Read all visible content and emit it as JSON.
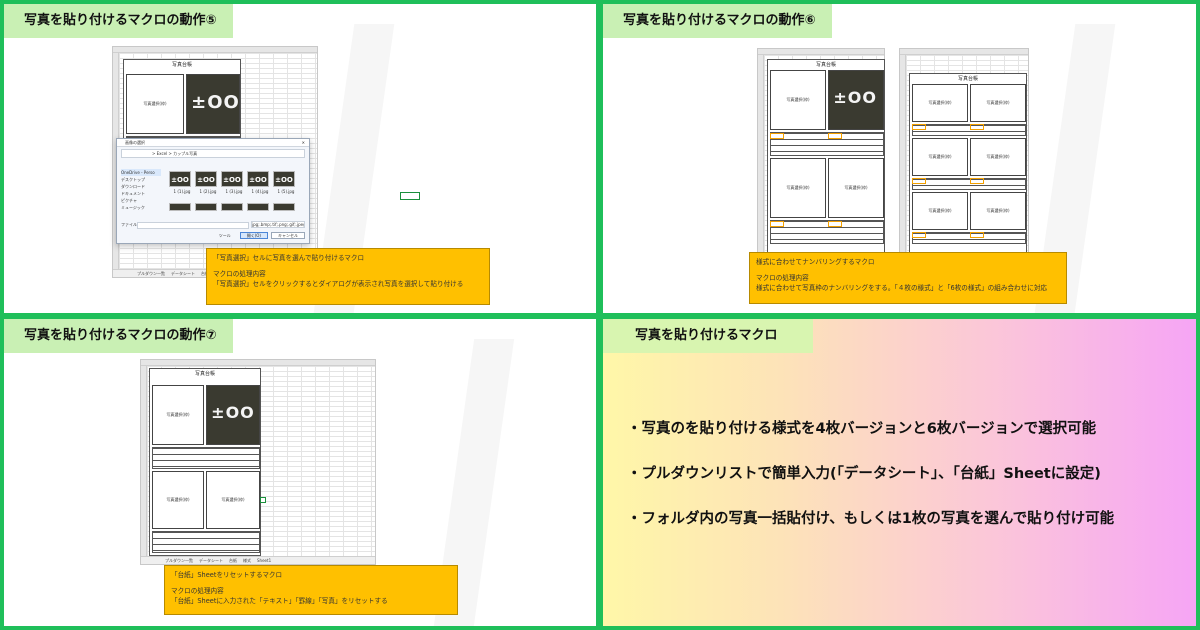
{
  "panels": [
    {
      "title": "写真を貼り付けるマクロの動作⑤",
      "note_lines": [
        "「写真選択」セルに写真を選んで貼り付けるマクロ",
        "",
        "マクロの処理内容",
        "「写真選択」セルをクリックするとダイアログが表示され写真を選択して貼り付ける"
      ]
    },
    {
      "title": "写真を貼り付けるマクロの動作⑥",
      "note_lines": [
        "様式に合わせてナンバリングするマクロ",
        "",
        "マクロの処理内容",
        "様式に合わせて写真枠のナンバリングをする。「４枚の様式」と「6枚の様式」の組み合わせに対応"
      ]
    },
    {
      "title": "写真を貼り付けるマクロの動作⑦",
      "note_lines": [
        "「台紙」Sheetをリセットするマクロ",
        "",
        "マクロの処理内容",
        "「台紙」Sheetに入力された「テキスト」「罫線」「写真」をリセットする"
      ]
    },
    {
      "title": "写真を貼り付けるマクロ",
      "bullets": [
        "・写真のを貼り付ける様式を4枚バージョンと6枚バージョンで選択可能",
        "・プルダウンリストで簡単入力(「データシート」、「台紙」Sheetに設定)",
        "・フォルダ内の写真一括貼付け、もしくは1枚の写真を選んで貼り付け可能"
      ]
    }
  ],
  "sheet": {
    "form_title": "写真台帳",
    "photo_select_label": "写真選択(枠)",
    "photo_text": "±OO",
    "tabs": [
      "プルダウン一覧",
      "データシート",
      "台紙",
      "様式",
      "Sheet1"
    ]
  },
  "dialog": {
    "title": "画像の選択",
    "path": "> Excel > カップル写真",
    "sidebar": [
      "OneDrive - Perso",
      "デスクトップ",
      "ダウンロード",
      "ドキュメント",
      "ピクチャ",
      "ミュージック"
    ],
    "thumb_label": "±OO",
    "thumb_names": [
      "1 (1).jpg",
      "1 (2).jpg",
      "1 (3).jpg",
      "1 (4).jpg",
      "1 (5).jpg"
    ],
    "filename_label": "ファイル名(N):",
    "filter": "jpg;.bmp;.tif;.png;.gif;.jpeg;.tiff",
    "tool_label": "ツール",
    "open_label": "開く(O)",
    "cancel_label": "キャンセル"
  },
  "colors": {
    "frame": "#1fbf5a",
    "title_tab": "#c9f0b4",
    "note": "#ffc000",
    "gradient_start": "#fff7a8",
    "gradient_end": "#f6a5f5"
  }
}
